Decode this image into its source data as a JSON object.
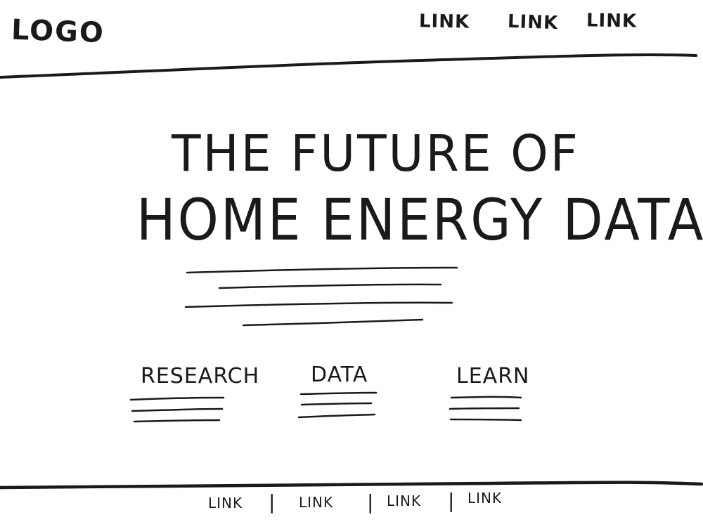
{
  "header": {
    "logo": "LOGO",
    "nav_links": [
      "LINK",
      "LINK",
      "LINK"
    ]
  },
  "hero": {
    "title_line1": "THE FUTURE OF",
    "title_line2": "HOME ENERGY DATA"
  },
  "sections": [
    {
      "label": "RESEARCH"
    },
    {
      "label": "DATA"
    },
    {
      "label": "LEARN"
    }
  ],
  "footer": {
    "links": [
      "LINK",
      "LINK",
      "LINK",
      "LINK"
    ],
    "separator": "|"
  },
  "colors": {
    "ink": "#1a1a1a",
    "background": "#ffffff"
  }
}
